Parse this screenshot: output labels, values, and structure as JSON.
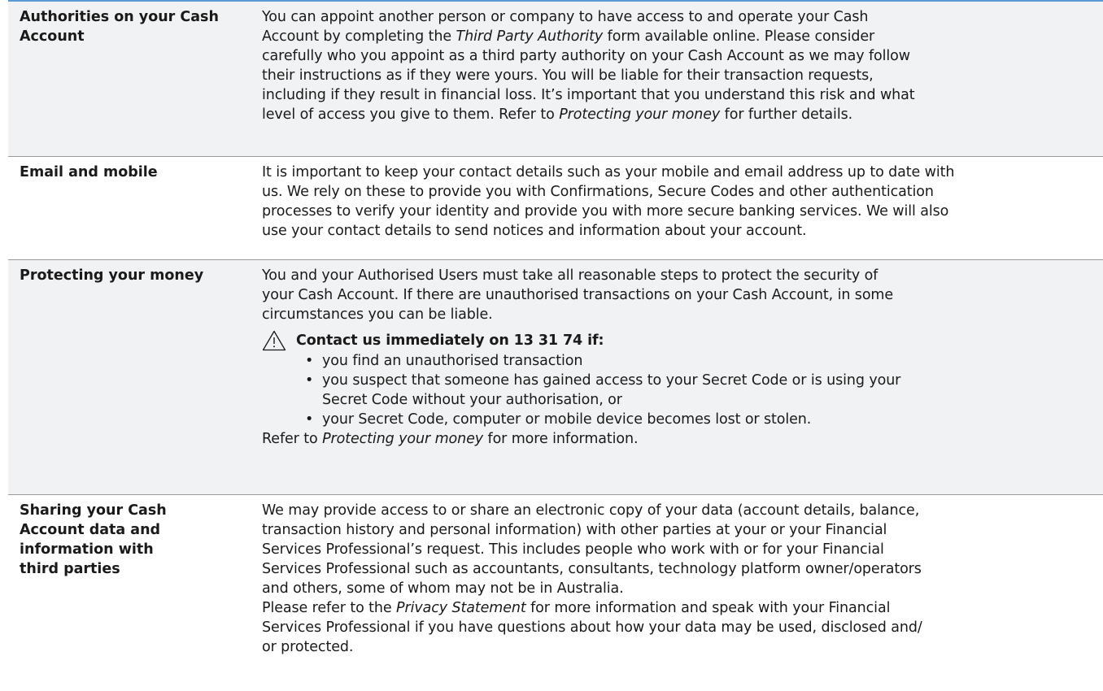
{
  "rows": [
    {
      "term": [
        "Authorities on your Cash",
        "Account"
      ],
      "desc": {
        "l1": "You can appoint another person or company to have access to and operate your Cash",
        "l2a": "Account by completing the ",
        "l2i": "Third Party Authority",
        "l2b": " form available online. Please consider",
        "l3": "carefully who you appoint as a third party authority on your Cash Account as we may follow",
        "l4": "their instructions as if they were yours. You will be liable for their transaction requests,",
        "l5": "including if they result in financial loss. It’s important that you understand this risk and what",
        "l6a": "level of access you give to them. Refer to ",
        "l6i": "Protecting your money",
        "l6b": " for further details."
      }
    },
    {
      "term": [
        "Email and mobile"
      ],
      "desc": {
        "l1": "It is important to keep your contact details such as your mobile and email address up to date with",
        "l2": "us. We rely on these to provide you with Confirmations, Secure Codes and other authentication",
        "l3": "processes to verify your identity and provide you with more secure banking services. We will also",
        "l4": "use your contact details to send notices and information about your account."
      }
    },
    {
      "term": [
        "Protecting your money"
      ],
      "desc": {
        "l1": "You and your Authorised Users must take all reasonable steps to protect the security of",
        "l2": "your Cash Account. If there are unauthorised transactions on your Cash Account, in some",
        "l3": "circumstances you can be liable.",
        "warning": "Contact us immediately on 13 31 74 if:",
        "bullets": [
          [
            "you find an unauthorised transaction"
          ],
          [
            "you suspect that someone has gained access to your Secret Code or is using your",
            "Secret Code without your authorisation, or"
          ],
          [
            "your Secret Code, computer or mobile device becomes lost or stolen."
          ]
        ],
        "refer_a": "Refer to ",
        "refer_i": "Protecting your money",
        "refer_b": " for more information."
      }
    },
    {
      "term": [
        "Sharing your Cash",
        "Account data and",
        "information with",
        "third parties"
      ],
      "desc": {
        "l1": "We may provide access to or share an electronic copy of your data (account details, balance,",
        "l2": "transaction history and personal information) with other parties at your or your Financial",
        "l3": "Services Professional’s request. This includes people who work with or for your Financial",
        "l4": "Services Professional such as accountants, consultants, technology platform owner/operators",
        "l5": "and others, some of whom may not be in Australia.",
        "l6a": "Please refer to the ",
        "l6i": "Privacy Statement",
        "l6b": " for more information and speak with your Financial",
        "l7": "Services Professional if you have questions about how your data may be used, disclosed and/",
        "l8": "or protected."
      }
    }
  ],
  "bullet_char": "•",
  "icons": {
    "warning": "warning-triangle-icon"
  },
  "colors": {
    "rule": "#5b9bd5",
    "shade": "#f1f2f3",
    "divider": "#9a9a9a"
  }
}
